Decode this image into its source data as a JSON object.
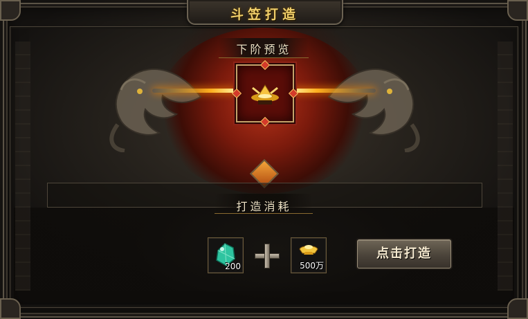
{
  "window": {
    "title": "斗笠打造"
  },
  "preview": {
    "label": "下阶预览",
    "item_icon": "golden-straw-hat-icon"
  },
  "cost": {
    "label": "打造消耗",
    "items": [
      {
        "icon": "jade-stone-icon",
        "quantity": "200"
      },
      {
        "icon": "gold-ingot-icon",
        "quantity": "500万"
      }
    ]
  },
  "actions": {
    "forge_label": "点击打造"
  },
  "colors": {
    "title_gold": "#f0cf6a",
    "glow_orange": "#ffb020",
    "slot_red": "#5b0d08",
    "jade_green": "#2ec4a0"
  }
}
